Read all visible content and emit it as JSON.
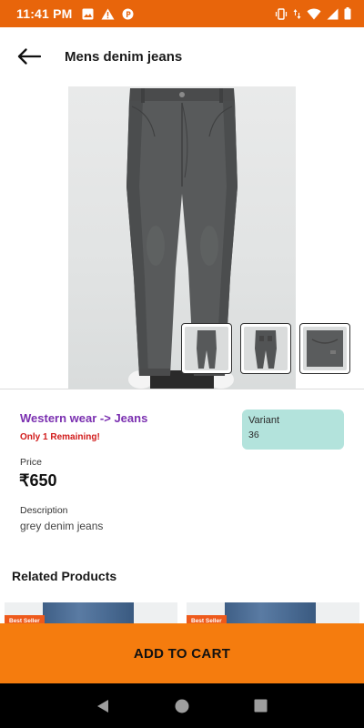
{
  "status_bar": {
    "time": "11:41 PM",
    "left_icons": [
      "image-icon",
      "warning-icon",
      "parking-icon"
    ],
    "right_icons": [
      "vibrate-icon",
      "data-arrows-icon",
      "wifi-icon",
      "signal-icon",
      "battery-icon"
    ]
  },
  "app_bar": {
    "back_icon": "arrow-left-icon",
    "title": "Mens denim jeans"
  },
  "product": {
    "category_path": "Western wear -> Jeans",
    "stock_notice": "Only 1 Remaining!",
    "variant": {
      "label": "Variant",
      "value": "36"
    },
    "price_label": "Price",
    "price": "₹650",
    "description_label": "Description",
    "description": "grey denim jeans",
    "thumbnail_count": 3
  },
  "related": {
    "title": "Related Products",
    "cards": [
      {
        "badge": "Best Seller"
      },
      {
        "badge": "Best Seller"
      }
    ]
  },
  "cta": {
    "label": "ADD TO CART"
  },
  "nav_bar": {
    "icons": [
      "back-triangle-icon",
      "home-circle-icon",
      "recents-square-icon"
    ]
  },
  "colors": {
    "status_bar": "#e8650b",
    "category_link": "#7a2fb0",
    "stock_notice": "#d11a1a",
    "variant_bg": "#b3e3dc",
    "add_to_cart_bg": "#f57c0e",
    "best_seller_badge": "#ee5a1c"
  }
}
